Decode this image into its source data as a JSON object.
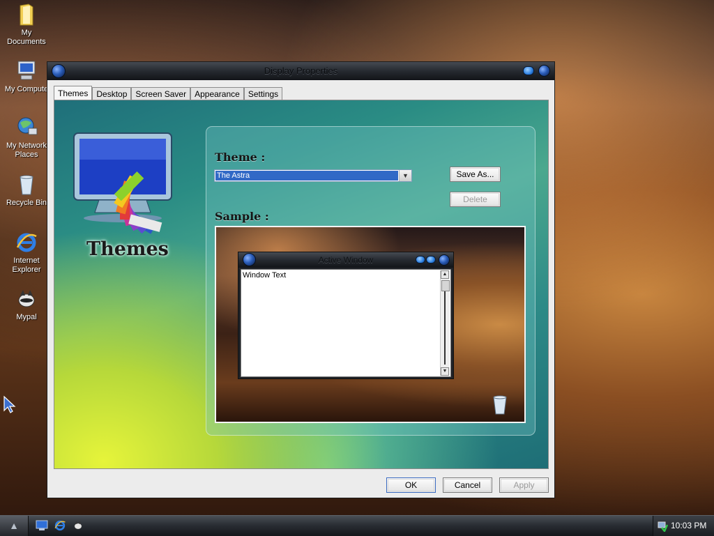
{
  "desktop": {
    "icons": [
      {
        "label": "My Documents",
        "icon": "folder-icon"
      },
      {
        "label": "My Compute",
        "icon": "computer-icon"
      },
      {
        "label": "My Network Places",
        "icon": "network-icon"
      },
      {
        "label": "Recycle Bin",
        "icon": "recycle-bin-icon"
      },
      {
        "label": "Internet Explorer",
        "icon": "internet-explorer-icon"
      },
      {
        "label": "Mypal",
        "icon": "mypal-icon"
      }
    ]
  },
  "window": {
    "title": "Display Properties",
    "tabs": [
      {
        "label": "Themes",
        "active": true
      },
      {
        "label": "Desktop"
      },
      {
        "label": "Screen Saver"
      },
      {
        "label": "Appearance"
      },
      {
        "label": "Settings"
      }
    ],
    "logo_text": "Themes",
    "theme_label": "Theme :",
    "theme_value": "The Astra",
    "save_as_label": "Save As...",
    "delete_label": "Delete",
    "sample_label": "Sample :",
    "sample": {
      "window_title": "Active Window",
      "window_text": "Window Text"
    },
    "ok_label": "OK",
    "cancel_label": "Cancel",
    "apply_label": "Apply"
  },
  "taskbar": {
    "clock": "10:03 PM"
  },
  "colors": {
    "selection": "#3169c6",
    "title_orb": "#2a5cb8"
  }
}
